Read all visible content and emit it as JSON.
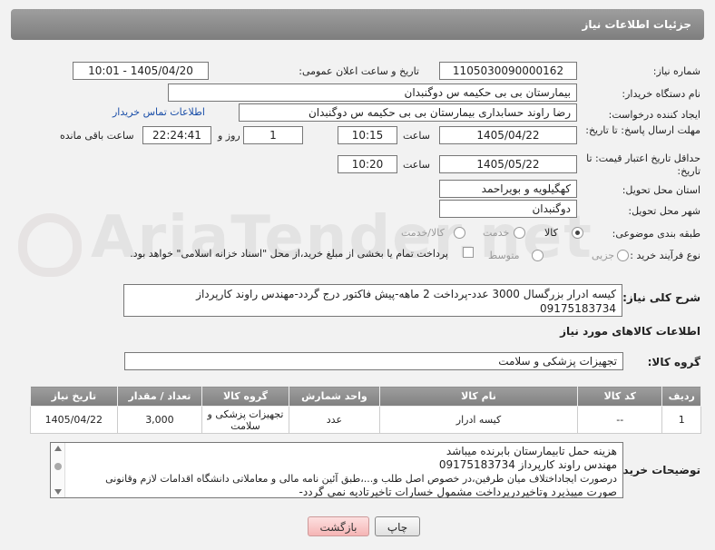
{
  "header": {
    "title": "جزئیات اطلاعات نیاز"
  },
  "fields": {
    "need_number_label": "شماره نیاز:",
    "need_number": "1105030090000162",
    "announce_label": "تاریخ و ساعت اعلان عمومی:",
    "announce_value": "1405/04/20 - 10:01",
    "buyer_org_label": "نام دستگاه خریدار:",
    "buyer_org": "بیمارستان بی بی حکیمه س  دوگنبدان",
    "creator_label": "ایجاد کننده درخواست:",
    "creator": "رضا راوند حسابداری بیمارستان بی بی حکیمه س  دوگنبدان",
    "contact_link": "اطلاعات تماس خریدار",
    "reply_deadline_label": "مهلت ارسال پاسخ: تا تاریخ:",
    "reply_date": "1405/04/22",
    "time_label": "ساعت",
    "reply_time": "10:15",
    "days_value": "1",
    "days_label": "روز و",
    "remaining_time": "22:24:41",
    "remaining_label": "ساعت باقی مانده",
    "price_validity_label": "حداقل تاریخ اعتبار قیمت: تا تاریخ:",
    "price_date": "1405/05/22",
    "time_label2": "ساعت",
    "price_time": "10:20",
    "province_label": "استان محل تحویل:",
    "province": "کهگیلویه و بویراحمد",
    "city_label": "شهر محل تحویل:",
    "city": "دوگنبدان",
    "category_label": "طبقه بندی موضوعی:",
    "category_options": [
      "کالا",
      "خدمت",
      "کالا/خدمت"
    ],
    "process_label": "نوع فرآیند خرید :",
    "process_options": [
      "جزیی",
      "متوسط"
    ],
    "payment_note": "پرداخت تمام یا بخشی از مبلغ خرید،از محل \"اسناد خزانه اسلامی\" خواهد بود."
  },
  "description": {
    "label": "شرح کلی نیاز:",
    "text": "کیسه ادرار بزرگسال 3000 عدد-پرداخت 2 ماهه-پیش فاکتور درج گردد-مهندس راوند کارپرداز  09175183734"
  },
  "goods_section": {
    "title": "اطلاعات کالاهای مورد نیاز"
  },
  "goods_group": {
    "label": "گروه کالا:",
    "value": "تجهیزات پزشکی و سلامت"
  },
  "table": {
    "headers": [
      "ردیف",
      "کد کالا",
      "نام کالا",
      "واحد شمارش",
      "گروه کالا",
      "تعداد / مقدار",
      "تاریخ نیاز"
    ],
    "rows": [
      [
        "1",
        "--",
        "کیسه ادرار",
        "عدد",
        "تجهیزات پزشکی و سلامت",
        "3,000",
        "1405/04/22"
      ]
    ]
  },
  "buyer_notes": {
    "label": "توضیحات خریدار:",
    "lines": [
      "هزینه حمل تابیمارستان بابرنده میباشد",
      "مهندس  راوند کارپرداز  09175183734",
      "درصورت ایجاداختلاف میان طرفین،در خصوص اصل طلب و...،طبق آئین نامه مالی و معاملاتی دانشگاه اقدامات لازم وقانونی",
      "صورت میپذیرد وتاخیردرپرداخت مشمول خسارات تاخیرتادیه نمی گردد-"
    ]
  },
  "buttons": {
    "print": "چاپ",
    "back": "بازگشت"
  }
}
